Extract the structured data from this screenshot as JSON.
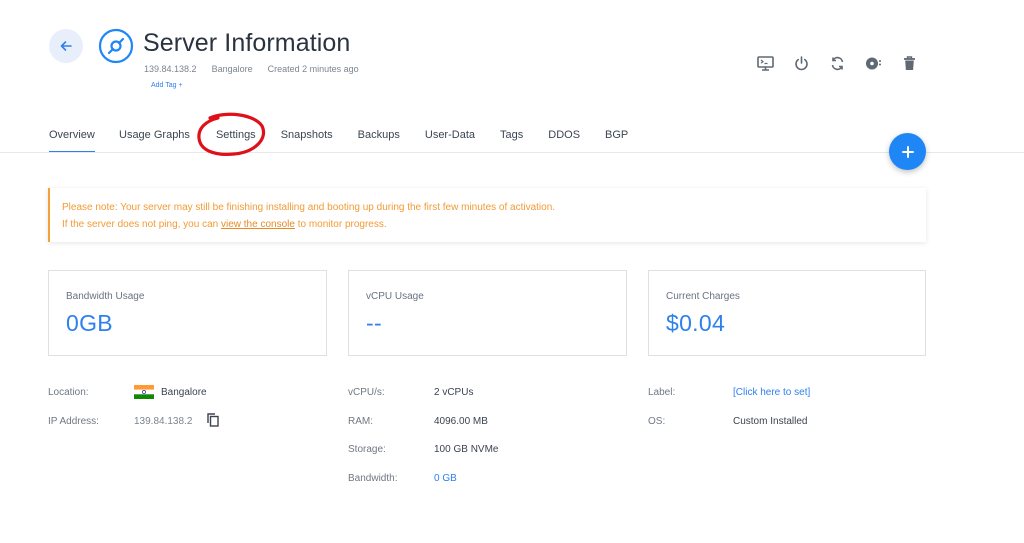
{
  "header": {
    "title": "Server Information",
    "ip": "139.84.138.2",
    "location": "Bangalore",
    "created": "Created 2 minutes ago",
    "add_tag": "Add Tag +"
  },
  "actions": [
    {
      "icon": "console-icon"
    },
    {
      "icon": "power-icon"
    },
    {
      "icon": "restart-icon"
    },
    {
      "icon": "iso-icon"
    },
    {
      "icon": "delete-icon"
    }
  ],
  "tabs": [
    {
      "label": "Overview",
      "active": true
    },
    {
      "label": "Usage Graphs"
    },
    {
      "label": "Settings"
    },
    {
      "label": "Snapshots"
    },
    {
      "label": "Backups"
    },
    {
      "label": "User-Data"
    },
    {
      "label": "Tags"
    },
    {
      "label": "DDOS"
    },
    {
      "label": "BGP"
    }
  ],
  "notice": {
    "line1": "Please note: Your server may still be finishing installing and booting up during the first few minutes of activation.",
    "line2_pre": "If the server does not ping, you can ",
    "line2_link": "view the console",
    "line2_post": " to monitor progress."
  },
  "cards": [
    {
      "label": "Bandwidth Usage",
      "value": "0GB"
    },
    {
      "label": "vCPU Usage",
      "value": "--"
    },
    {
      "label": "Current Charges",
      "value": "$0.04"
    }
  ],
  "details": {
    "location_label": "Location:",
    "location_value": "Bangalore",
    "ip_label": "IP Address:",
    "ip_value": "139.84.138.2",
    "vcpu_label": "vCPU/s:",
    "vcpu_value": "2 vCPUs",
    "ram_label": "RAM:",
    "ram_value": "4096.00 MB",
    "storage_label": "Storage:",
    "storage_value": "100 GB NVMe",
    "bandwidth_label": "Bandwidth:",
    "bandwidth_value": "0 GB",
    "label_label": "Label:",
    "label_value": "[Click here to set]",
    "os_label": "OS:",
    "os_value": "Custom Installed"
  },
  "colors": {
    "accent": "#2f80ed",
    "warning": "#f29b35",
    "annotation": "#e0101a"
  }
}
